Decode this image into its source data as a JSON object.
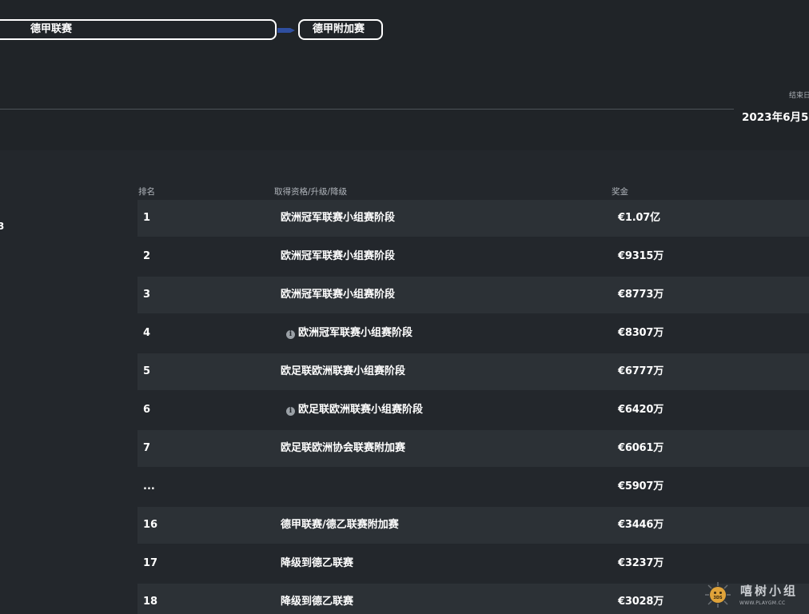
{
  "header": {
    "league_pill": "德甲联赛",
    "playoff_pill": "德甲附加赛",
    "end_date_label": "结束日",
    "end_date_value": "2023年6月5",
    "left_stub": "3"
  },
  "colors": {
    "background": "#23272c",
    "row_shaded": "#2c3136",
    "connector_arrow": "#2f4fa0"
  },
  "table": {
    "headers": {
      "rank": "排名",
      "qualification": "取得资格/升级/降级",
      "prize": "奖金"
    },
    "rows": [
      {
        "rank": "1",
        "qualification": "欧洲冠军联赛小组赛阶段",
        "prize": "€1.07亿",
        "info": false
      },
      {
        "rank": "2",
        "qualification": "欧洲冠军联赛小组赛阶段",
        "prize": "€9315万",
        "info": false
      },
      {
        "rank": "3",
        "qualification": "欧洲冠军联赛小组赛阶段",
        "prize": "€8773万",
        "info": false
      },
      {
        "rank": "4",
        "qualification": "欧洲冠军联赛小组赛阶段",
        "prize": "€8307万",
        "info": true
      },
      {
        "rank": "5",
        "qualification": "欧足联欧洲联赛小组赛阶段",
        "prize": "€6777万",
        "info": false
      },
      {
        "rank": "6",
        "qualification": "欧足联欧洲联赛小组赛阶段",
        "prize": "€6420万",
        "info": true
      },
      {
        "rank": "7",
        "qualification": "欧足联欧洲协会联赛附加赛",
        "prize": "€6061万",
        "info": false
      },
      {
        "rank": "...",
        "qualification": "",
        "prize": "€5907万",
        "info": false
      },
      {
        "rank": "16",
        "qualification": "德甲联赛/德乙联赛附加赛",
        "prize": "€3446万",
        "info": false
      },
      {
        "rank": "17",
        "qualification": "降级到德乙联赛",
        "prize": "€3237万",
        "info": false
      },
      {
        "rank": "18",
        "qualification": "降级到德乙联赛",
        "prize": "€3028万",
        "info": false
      }
    ]
  },
  "watermark": {
    "title": "嘻树小组",
    "url": "WWW.PLAYGM.CC",
    "logo_text": "3DS"
  }
}
